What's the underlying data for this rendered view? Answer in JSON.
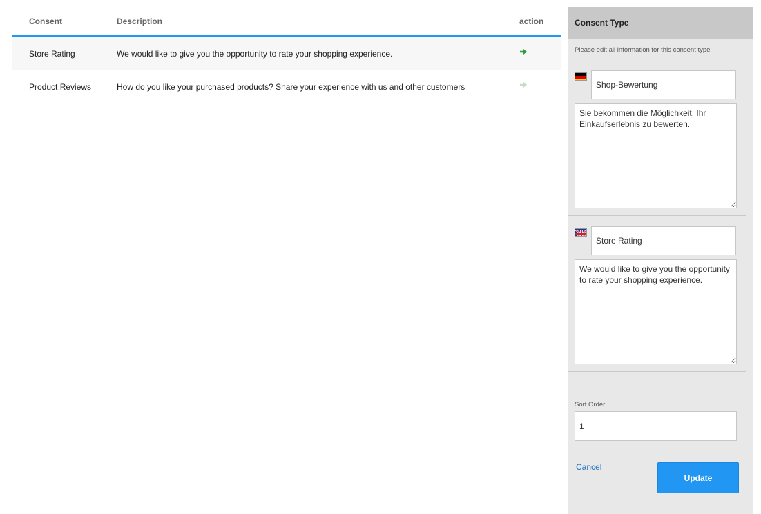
{
  "colors": {
    "accent": "#2196f3",
    "arrow_active": "#2e9e3a",
    "arrow_inactive": "#c5dcc8",
    "panel_bg": "#e8e8e8",
    "panel_header_bg": "#c8c8c8",
    "link": "#1e73be"
  },
  "table": {
    "headers": {
      "consent": "Consent",
      "description": "Description",
      "action": "action"
    },
    "rows": [
      {
        "consent": "Store Rating",
        "description": "We would like to give you the opportunity to rate your shopping experience.",
        "action_icon": "arrow-right-icon",
        "selected": true
      },
      {
        "consent": "Product Reviews",
        "description": "How do you like your purchased products? Share your experience with us and other customers",
        "action_icon": "arrow-right-icon",
        "selected": false
      }
    ]
  },
  "panel": {
    "title": "Consent Type",
    "subtitle": "Please edit all information for this consent type",
    "languages": [
      {
        "flag_icon": "german-flag-icon",
        "title": "Shop-Bewertung",
        "description": "Sie bekommen die Möglichkeit, Ihr Einkaufserlebnis zu bewerten."
      },
      {
        "flag_icon": "uk-flag-icon",
        "title": "Store Rating",
        "description": "We would like to give you the opportunity to rate your shopping experience."
      }
    ],
    "sort_order_label": "Sort Order",
    "sort_order_value": "1",
    "cancel_label": "Cancel",
    "update_label": "Update"
  }
}
